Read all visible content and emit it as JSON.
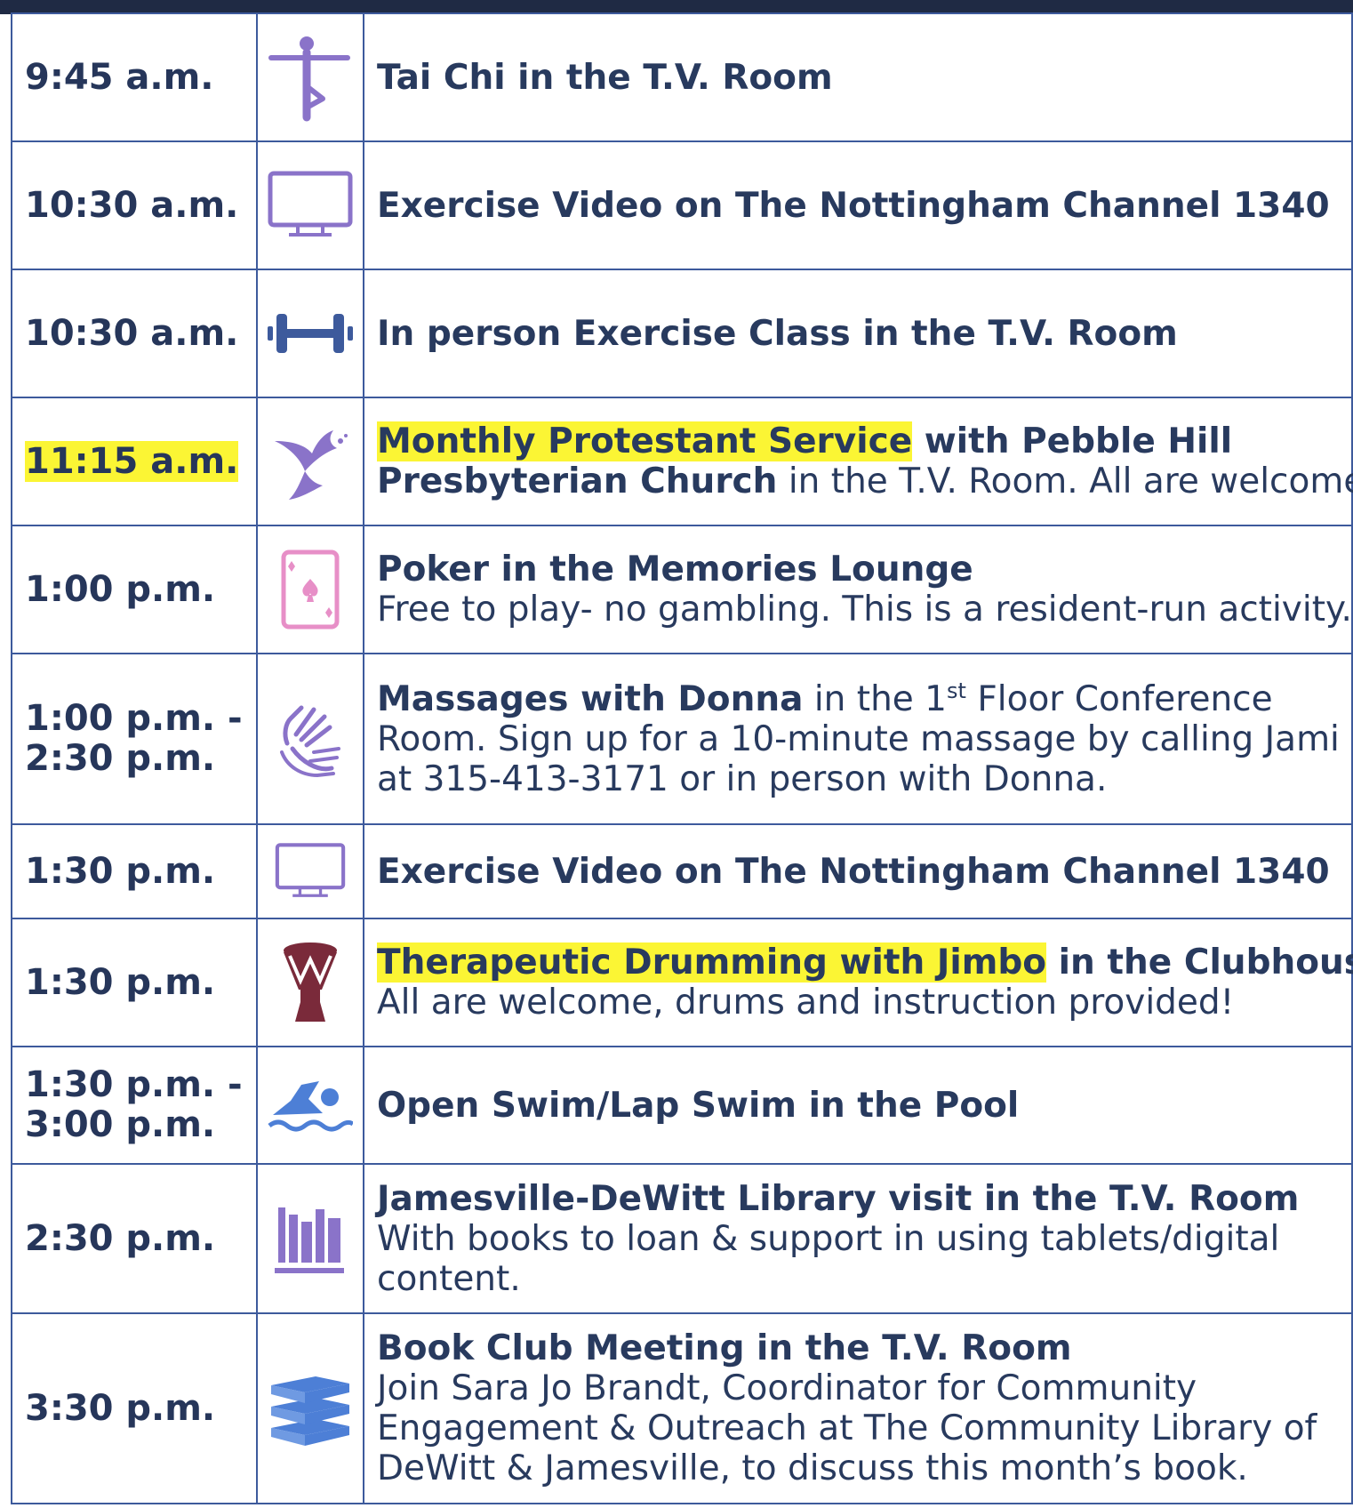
{
  "colors": {
    "grid": "#3d5a9c",
    "text": "#283a5e",
    "highlight": "#fbf534",
    "icon_purple": "#8a73c9",
    "icon_pink": "#e78fc7",
    "icon_blue": "#4d7fd6",
    "drum": "#7a2a3a"
  },
  "rows": [
    {
      "time1": "9:45 a.m.",
      "icon": "tai-chi-figure-icon",
      "l1b": "Tai Chi in the T.V. Room"
    },
    {
      "time1": "10:30 a.m.",
      "icon": "tv-monitor-icon",
      "l1b": "Exercise Video on The Nottingham Channel 1340"
    },
    {
      "time1": "10:30 a.m.",
      "icon": "dumbbell-icon",
      "l1b": "In person Exercise Class in the T.V. Room"
    },
    {
      "time1": "11:15 a.m.",
      "icon": "dove-icon",
      "l1hl": "Monthly Protestant Service",
      "l1b": " with Pebble Hill",
      "l2b": "Presbyterian Church",
      "l2": " in the T.V. Room. All are welcome."
    },
    {
      "time1": "1:00 p.m.",
      "icon": "playing-card-icon",
      "l1b": "Poker in the Memories Lounge",
      "l2": "Free to play- no gambling. This is a resident-run activity."
    },
    {
      "time1": "1:00 p.m. -",
      "time2": "2:30 p.m.",
      "icon": "sign-language-hands-icon",
      "l1b": "Massages with Donna",
      "l1a": " in the 1",
      "l1sup": "st",
      "l1c": " Floor Conference",
      "l2": "Room. Sign up for a 10-minute massage by calling Jami",
      "l3": "at 315-413-3171 or in person with Donna."
    },
    {
      "time1": "1:30 p.m.",
      "icon": "tv-monitor-icon",
      "l1b": "Exercise Video on The Nottingham Channel 1340"
    },
    {
      "time1": "1:30 p.m.",
      "icon": "drum-icon",
      "l1hl": "Therapeutic Drumming with Jimbo",
      "l1b": " in the Clubhouse.",
      "l2": "All are welcome, drums and instruction provided!"
    },
    {
      "time1": "1:30 p.m. -",
      "time2": "3:00 p.m.",
      "icon": "swimmer-icon",
      "l1b": "Open Swim/Lap Swim in the Pool"
    },
    {
      "time1": "2:30 p.m.",
      "icon": "bookshelf-icon",
      "l1b": "Jamesville-DeWitt Library visit in the T.V. Room",
      "l2": "With books to loan & support in using tablets/digital",
      "l3": "content."
    },
    {
      "time1": "3:30 p.m.",
      "icon": "book-stack-icon",
      "l1b": "Book Club Meeting in the T.V. Room",
      "l2": "Join Sara Jo Brandt, Coordinator for Community",
      "l3": "Engagement & Outreach at The Community Library of",
      "l4": "DeWitt & Jamesville, to discuss this month’s book."
    }
  ]
}
